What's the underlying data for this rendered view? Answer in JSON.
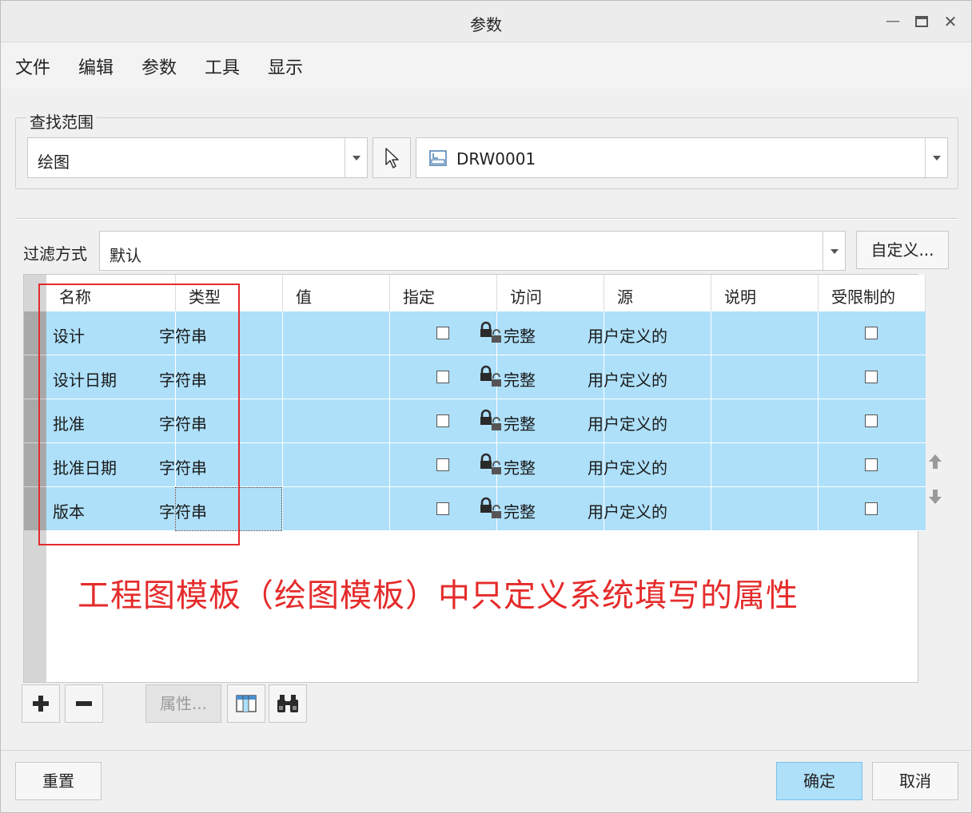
{
  "window": {
    "title": "参数"
  },
  "menu": [
    "文件",
    "编辑",
    "参数",
    "工具",
    "显示"
  ],
  "lookup": {
    "group_title": "查找范围",
    "scope_value": "绘图",
    "object_value": "DRW0001"
  },
  "filter": {
    "label": "过滤方式",
    "value": "默认",
    "custom_button": "自定义..."
  },
  "table": {
    "columns": [
      "名称",
      "类型",
      "值",
      "指定",
      "访问",
      "源",
      "说明",
      "受限制的"
    ],
    "rows": [
      {
        "name": "设计",
        "type": "字符串",
        "value": "",
        "designate": false,
        "access": "完整",
        "source": "用户定义的",
        "description": "",
        "restricted": false
      },
      {
        "name": "设计日期",
        "type": "字符串",
        "value": "",
        "designate": false,
        "access": "完整",
        "source": "用户定义的",
        "description": "",
        "restricted": false
      },
      {
        "name": "批准",
        "type": "字符串",
        "value": "",
        "designate": false,
        "access": "完整",
        "source": "用户定义的",
        "description": "",
        "restricted": false
      },
      {
        "name": "批准日期",
        "type": "字符串",
        "value": "",
        "designate": false,
        "access": "完整",
        "source": "用户定义的",
        "description": "",
        "restricted": false
      },
      {
        "name": "版本",
        "type": "字符串",
        "value": "",
        "designate": false,
        "access": "完整",
        "source": "用户定义的",
        "description": "",
        "restricted": false
      }
    ]
  },
  "annotation": {
    "text": "工程图模板（绘图模板）中只定义系统填写的属性",
    "color": "#e52b2b"
  },
  "toolbar": {
    "add": "+",
    "remove": "−",
    "properties": "属性..."
  },
  "footer": {
    "reset": "重置",
    "ok": "确定",
    "cancel": "取消"
  },
  "colors": {
    "row_selected": "#aee0fa",
    "ok_button": "#aee0fa"
  }
}
